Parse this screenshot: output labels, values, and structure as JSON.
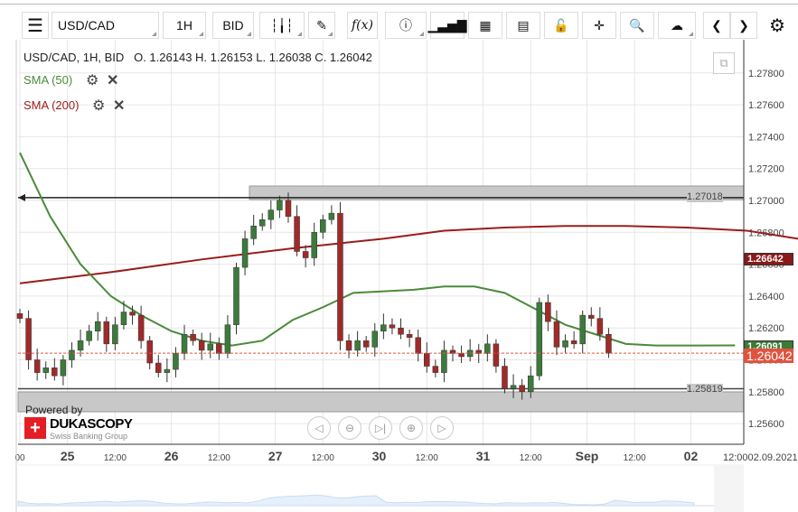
{
  "toolbar": {
    "symbol": "USD/CAD",
    "period": "1H",
    "side": "BID",
    "icons": [
      "menu-icon",
      "candle-type-icon",
      "draw-icon",
      "function-icon",
      "info-icon",
      "volume-icon",
      "calendar-icon",
      "report-icon",
      "lock-icon",
      "crosshair-icon",
      "zoom-search-icon",
      "cloud-upload-icon",
      "prev-icon",
      "next-icon",
      "gear-icon"
    ],
    "function_label": "f(x)",
    "info_label": "i"
  },
  "legend": {
    "title": "USD/CAD, 1H, BID",
    "ohlc": "O. 1.26143 H. 1.26153 L. 1.26038 C. 1.26042",
    "sma50": "SMA (50)",
    "sma200": "SMA (200)"
  },
  "colors": {
    "sma50": "#4a8a3a",
    "sma200": "#9b1c1c",
    "bull": "#3c7a3c",
    "bear": "#a02a2a",
    "last": "#e0533f"
  },
  "levels": {
    "upper": "1.27018",
    "lower": "1.25819"
  },
  "tags": {
    "sma200": "1.26642",
    "sma50": "1.26091",
    "last": "1.26042"
  },
  "branding": {
    "powered": "Powered by",
    "brand": "DUKASCOPY",
    "sub": "Swiss Banking Group"
  },
  "footer": {
    "datetime": "12:0002.09.2021"
  },
  "chart_data": {
    "type": "candlestick",
    "ylim": [
      1.255,
      1.283
    ],
    "yticks": [
      "1.27800",
      "1.27600",
      "1.27400",
      "1.27200",
      "1.27000",
      "1.26800",
      "1.26600",
      "1.26400",
      "1.26200",
      "1.26000",
      "1.25800",
      "1.25600"
    ],
    "xticks": [
      {
        "label": "00",
        "h": 0,
        "bold": false
      },
      {
        "label": "25",
        "h": 11,
        "bold": true
      },
      {
        "label": "12:00",
        "h": 22,
        "bold": false
      },
      {
        "label": "26",
        "h": 35,
        "bold": true
      },
      {
        "label": "12:00",
        "h": 46,
        "bold": false
      },
      {
        "label": "27",
        "h": 59,
        "bold": true
      },
      {
        "label": "12:00",
        "h": 70,
        "bold": false
      },
      {
        "label": "30",
        "h": 83,
        "bold": true
      },
      {
        "label": "12:00",
        "h": 94,
        "bold": false
      },
      {
        "label": "31",
        "h": 107,
        "bold": true
      },
      {
        "label": "12:00",
        "h": 118,
        "bold": false
      },
      {
        "label": "Sep",
        "h": 131,
        "bold": true
      },
      {
        "label": "12:00",
        "h": 142,
        "bold": false
      },
      {
        "label": "02",
        "h": 155,
        "bold": true
      }
    ],
    "candle_hours": 2,
    "closes": [
      1.2626,
      1.26,
      1.2592,
      1.2595,
      1.259,
      1.26,
      1.2606,
      1.2612,
      1.2618,
      1.2624,
      1.261,
      1.2622,
      1.263,
      1.2628,
      1.2612,
      1.2598,
      1.2592,
      1.2594,
      1.2604,
      1.2616,
      1.2612,
      1.2606,
      1.261,
      1.2604,
      1.2622,
      1.2658,
      1.2676,
      1.2684,
      1.2688,
      1.2694,
      1.27,
      1.269,
      1.2668,
      1.2664,
      1.268,
      1.2688,
      1.2692,
      1.2612,
      1.2606,
      1.2612,
      1.2608,
      1.2618,
      1.2622,
      1.262,
      1.2616,
      1.2614,
      1.2604,
      1.2596,
      1.2592,
      1.2606,
      1.2604,
      1.2602,
      1.2606,
      1.2604,
      1.261,
      1.2596,
      1.2582,
      1.2584,
      1.258,
      1.259,
      1.2636,
      1.2624,
      1.2608,
      1.2612,
      1.261,
      1.2628,
      1.2626,
      1.2616,
      1.26042
    ],
    "sma50": [
      [
        0,
        1.273
      ],
      [
        10,
        1.269
      ],
      [
        20,
        1.266
      ],
      [
        30,
        1.264
      ],
      [
        40,
        1.2628
      ],
      [
        50,
        1.2618
      ],
      [
        60,
        1.2612
      ],
      [
        70,
        1.2609
      ],
      [
        80,
        1.2612
      ],
      [
        90,
        1.2625
      ],
      [
        100,
        1.2633
      ],
      [
        110,
        1.2642
      ],
      [
        120,
        1.2643
      ],
      [
        130,
        1.2644
      ],
      [
        140,
        1.2646
      ],
      [
        150,
        1.2646
      ],
      [
        160,
        1.2642
      ],
      [
        170,
        1.2632
      ],
      [
        180,
        1.2622
      ],
      [
        190,
        1.2616
      ],
      [
        200,
        1.261
      ],
      [
        210,
        1.2609
      ],
      [
        224,
        1.2609
      ],
      [
        236,
        1.26091
      ]
    ],
    "sma200": [
      [
        0,
        1.2648
      ],
      [
        30,
        1.2655
      ],
      [
        60,
        1.2663
      ],
      [
        90,
        1.267
      ],
      [
        120,
        1.2676
      ],
      [
        140,
        1.2681
      ],
      [
        160,
        1.2683
      ],
      [
        180,
        1.2684
      ],
      [
        200,
        1.2684
      ],
      [
        220,
        1.2683
      ],
      [
        240,
        1.2681
      ],
      [
        260,
        1.2675
      ],
      [
        275,
        1.267
      ],
      [
        290,
        1.2664
      ]
    ]
  }
}
